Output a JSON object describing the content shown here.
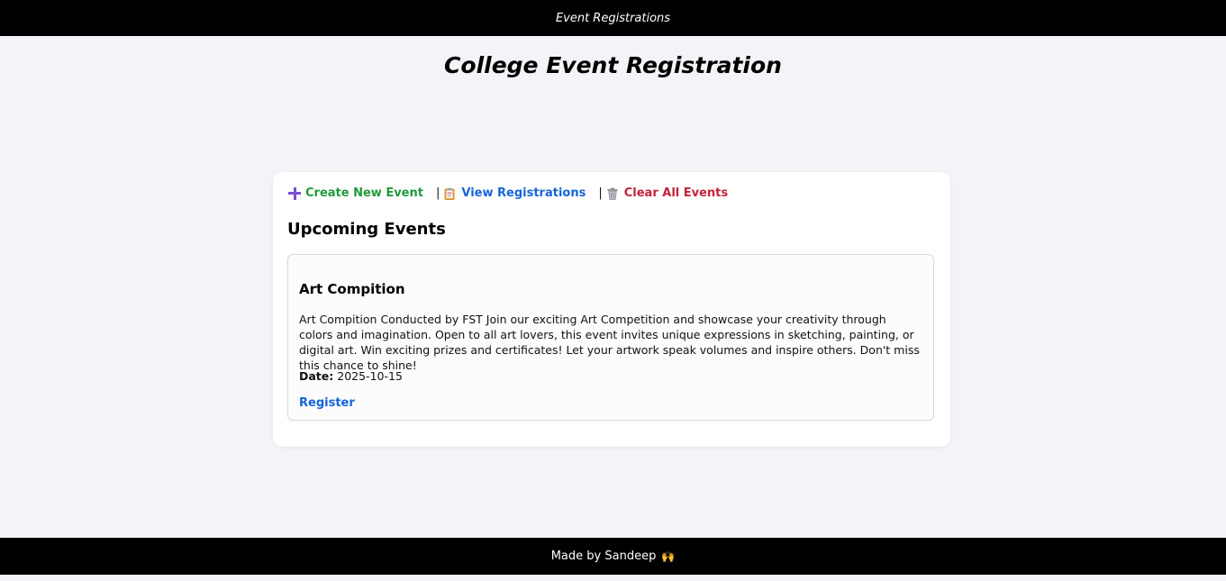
{
  "header": {
    "title": "Event Registrations"
  },
  "page": {
    "title": "College Event Registration"
  },
  "toolbar": {
    "create_label": "Create New Event",
    "view_label": "View Registrations",
    "clear_label": "Clear All Events",
    "separator": "|",
    "icons": [
      "plus-icon",
      "clipboard-icon",
      "trash-icon"
    ],
    "colors": {
      "create": "#1f9a3a",
      "view": "#1565d8",
      "clear": "#c4213a",
      "plus": "#7b4fd6"
    }
  },
  "events_section": {
    "title": "Upcoming Events",
    "events": [
      {
        "name": "Art Compition",
        "description": "Art Compition Conducted by FST Join our exciting Art Competition and showcase your creativity through colors and imagination. Open to all art lovers, this event invites unique expressions in sketching, painting, or digital art. Win exciting prizes and certificates! Let your artwork speak volumes and inspire others. Don't miss this chance to shine!",
        "date_label": "Date:",
        "date": "2025-10-15",
        "register_label": "Register"
      }
    ]
  },
  "footer": {
    "text": "Made by Sandeep",
    "emoji": "🙌"
  }
}
